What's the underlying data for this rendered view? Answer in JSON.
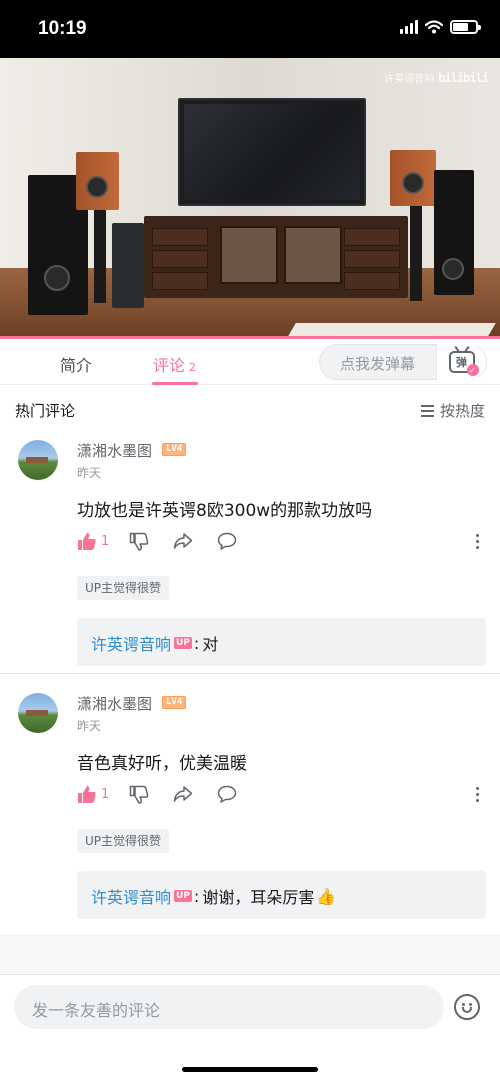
{
  "status_bar": {
    "time": "10:19"
  },
  "video": {
    "watermark_text": "许英谔音响",
    "watermark_logo": "bilibili",
    "progress": 1.0
  },
  "tabs": {
    "intro": "简介",
    "comments": "评论",
    "comments_count": "2",
    "danmaku_placeholder": "点我发弹幕",
    "danmaku_icon_text": "弹"
  },
  "section": {
    "title": "热门评论",
    "sort_label": "按热度"
  },
  "comments": [
    {
      "username": "潇湘水墨图",
      "level": "LV4",
      "time": "昨天",
      "text": "功放也是许英谔8欧300w的那款功放吗",
      "likes": "1",
      "up_liked": "UP主觉得很赞",
      "reply": {
        "name": "许英谔音响",
        "badge": "UP",
        "text": "对"
      }
    },
    {
      "username": "潇湘水墨图",
      "level": "LV4",
      "time": "昨天",
      "text": "音色真好听，优美温暖",
      "likes": "1",
      "up_liked": "UP主觉得很赞",
      "reply": {
        "name": "许英谔音响",
        "badge": "UP",
        "text": "谢谢，耳朵厉害",
        "emoji": "👍"
      }
    }
  ],
  "bottom": {
    "input_placeholder": "发一条友善的评论"
  },
  "colors": {
    "accent": "#fb7299",
    "link": "#2f8ccf"
  },
  "icons": [
    "signal-icon",
    "wifi-icon",
    "battery-icon",
    "danmaku-tv-icon",
    "sort-icon",
    "like-icon",
    "dislike-icon",
    "share-icon",
    "reply-icon",
    "more-icon",
    "emoji-icon"
  ]
}
